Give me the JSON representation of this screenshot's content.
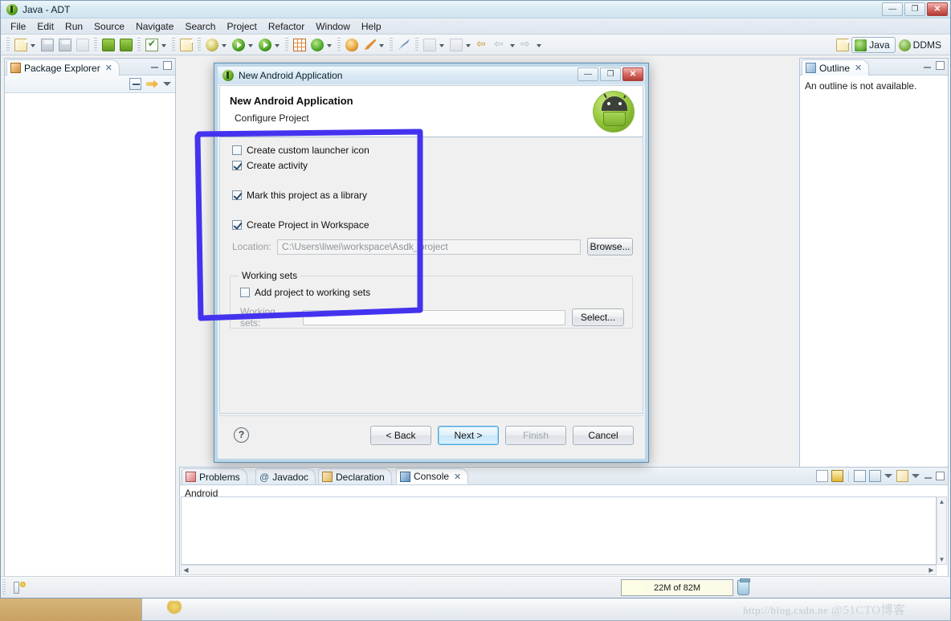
{
  "window": {
    "title": "Java - ADT",
    "logo_icon": "eclipse-logo-icon",
    "controls": {
      "minimize": "—",
      "maximize": "❐",
      "close": "✕"
    }
  },
  "menubar": {
    "items": [
      "File",
      "Edit",
      "Run",
      "Source",
      "Navigate",
      "Search",
      "Project",
      "Refactor",
      "Window",
      "Help"
    ]
  },
  "toolbar": {
    "icons": [
      "new-wizard-icon",
      "new-wizard-dropdown-icon",
      "save-icon",
      "save-all-icon",
      "print-icon",
      "android-sdk-manager-icon",
      "android-avd-manager-icon",
      "check-validate-icon",
      "check-validate-dropdown-icon",
      "new-android-project-icon",
      "debug-icon",
      "debug-dropdown-icon",
      "run-icon",
      "run-dropdown-icon",
      "run-coverage-icon",
      "run-coverage-dropdown-icon",
      "new-table-icon",
      "external-tools-icon",
      "external-tools-dropdown-icon",
      "open-type-icon",
      "search-icon",
      "search-dropdown-icon",
      "pin-editor-icon",
      "next-annotation-icon",
      "next-annotation-dropdown-icon",
      "previous-annotation-icon",
      "previous-annotation-dropdown-icon",
      "back-icon",
      "back-dropdown-icon",
      "forward-icon",
      "forward-dropdown-icon"
    ],
    "perspectives": {
      "open_perspective_icon": "open-perspective-icon",
      "items": [
        {
          "label": "Java",
          "icon": "java-perspective-icon",
          "active": true
        },
        {
          "label": "DDMS",
          "icon": "ddms-perspective-icon",
          "active": false
        }
      ]
    }
  },
  "package_explorer": {
    "tab_label": "Package Explorer",
    "tab_icon": "package-explorer-icon",
    "close_glyph": "✕",
    "toolbar_icons": [
      "collapse-all-icon",
      "link-with-editor-icon",
      "view-menu-icon"
    ],
    "minimize_glyph": "—",
    "maximize_glyph": "❐"
  },
  "outline": {
    "tab_label": "Outline",
    "tab_icon": "outline-icon",
    "close_glyph": "✕",
    "message": "An outline is not available.",
    "minimize_glyph": "—",
    "maximize_glyph": "❐"
  },
  "bottom_panel": {
    "tabs": [
      {
        "label": "Problems",
        "icon": "problems-icon",
        "active": false
      },
      {
        "label": "Javadoc",
        "icon": "javadoc-icon",
        "active": false
      },
      {
        "label": "Declaration",
        "icon": "declaration-icon",
        "active": false
      },
      {
        "label": "Console",
        "icon": "console-icon",
        "active": true
      }
    ],
    "close_glyph": "✕",
    "console_label": "Android",
    "toolbar_icons": [
      "clear-console-icon",
      "lock-scroll-icon",
      "show-console-when-output-icon",
      "display-selected-console-icon",
      "display-selected-console-dropdown-icon",
      "open-console-icon",
      "open-console-dropdown-icon"
    ],
    "minimize_glyph": "—",
    "maximize_glyph": "❐"
  },
  "statusbar": {
    "icon": "writable-insert-icon",
    "heap": {
      "text": "22M of 82M",
      "used_mb": 22,
      "total_mb": 82
    },
    "trash_icon": "run-garbage-collector-icon"
  },
  "dialog": {
    "titlebar": {
      "title": "New Android Application",
      "icon": "eclipse-logo-icon",
      "minimize": "—",
      "maximize": "❐",
      "close": "✕"
    },
    "header": {
      "title": "New Android Application",
      "subtitle": "Configure Project",
      "logo_icon": "android-droid-icon"
    },
    "checkboxes": [
      {
        "label": "Create custom launcher icon",
        "checked": false,
        "enabled": true
      },
      {
        "label": "Create activity",
        "checked": true,
        "enabled": true
      },
      {
        "label": "Mark this project as a library",
        "checked": true,
        "enabled": true
      },
      {
        "label": "Create Project in Workspace",
        "checked": true,
        "enabled": true
      }
    ],
    "location": {
      "label": "Location:",
      "value": "C:\\Users\\liwei\\workspace\\Asdk_project",
      "browse_label": "Browse..."
    },
    "working_sets": {
      "group_label": "Working sets",
      "add_checkbox": {
        "label": "Add project to working sets",
        "checked": false
      },
      "field_label": "Working sets:",
      "field_value": "",
      "select_label": "Select...",
      "dropdown_icon": "chevron-down-icon"
    },
    "footer": {
      "help_icon": "help-icon",
      "buttons": [
        {
          "label": "< Back",
          "enabled": true,
          "default": false
        },
        {
          "label": "Next >",
          "enabled": true,
          "default": true
        },
        {
          "label": "Finish",
          "enabled": false,
          "default": false
        },
        {
          "label": "Cancel",
          "enabled": true,
          "default": false
        }
      ]
    }
  },
  "annotation": {
    "type": "rectangle-highlight",
    "color": "#4433ee"
  },
  "watermark": {
    "url_text": "http://blog.csdn.ne",
    "site_text": "@51CTO博客"
  }
}
